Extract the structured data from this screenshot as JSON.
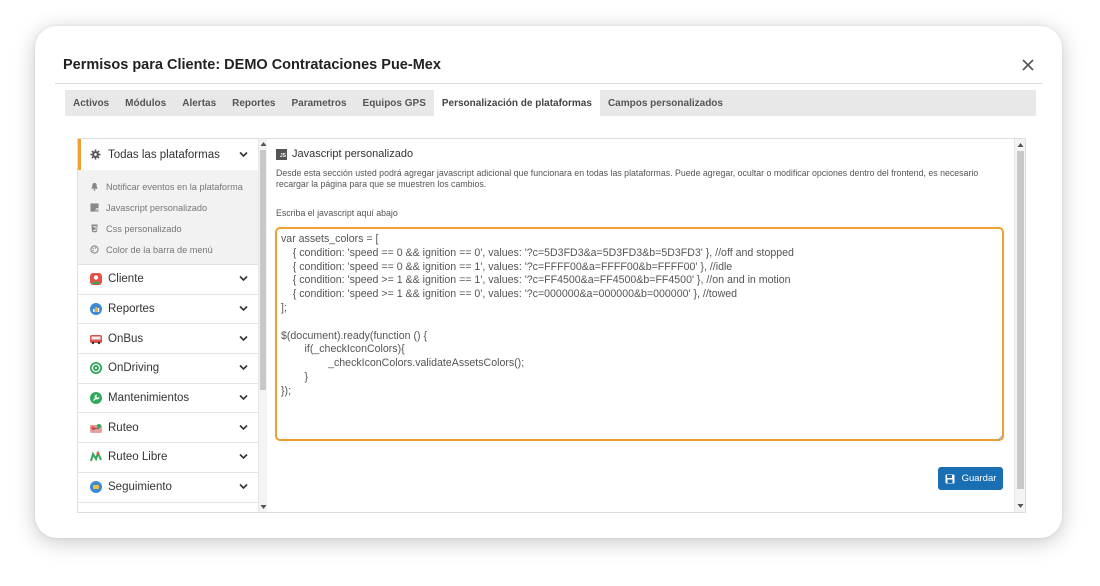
{
  "modal": {
    "title": "Permisos para Cliente: DEMO Contrataciones Pue-Mex"
  },
  "tabs": [
    {
      "label": "Activos"
    },
    {
      "label": "Módulos"
    },
    {
      "label": "Alertas"
    },
    {
      "label": "Reportes"
    },
    {
      "label": "Parametros"
    },
    {
      "label": "Equipos GPS"
    },
    {
      "label": "Personalización de plataformas",
      "active": true
    },
    {
      "label": "Campos personalizados"
    }
  ],
  "sidebar": {
    "header": {
      "label": "Todas las plataformas",
      "icon": "gear-icon"
    },
    "subitems": [
      {
        "label": "Notificar eventos en la plataforma",
        "icon": "bell-icon"
      },
      {
        "label": "Javascript personalizado",
        "icon": "js-file-icon"
      },
      {
        "label": "Css personalizado",
        "icon": "css-file-icon"
      },
      {
        "label": "Color de la barra de menú",
        "icon": "palette-icon"
      }
    ],
    "items": [
      {
        "label": "Cliente",
        "icon": "cliente-icon",
        "color": "#e8504a"
      },
      {
        "label": "Reportes",
        "icon": "reportes-icon",
        "color": "#3b8bd4"
      },
      {
        "label": "OnBus",
        "icon": "onbus-icon",
        "color": "#d9534f"
      },
      {
        "label": "OnDriving",
        "icon": "ondriving-icon",
        "color": "#2eaa5a"
      },
      {
        "label": "Mantenimientos",
        "icon": "mantenimientos-icon",
        "color": "#2eaa5a"
      },
      {
        "label": "Ruteo",
        "icon": "ruteo-icon",
        "color": "#e8504a"
      },
      {
        "label": "Ruteo Libre",
        "icon": "ruteo-libre-icon",
        "color": "#2eaa5a"
      },
      {
        "label": "Seguimiento",
        "icon": "seguimiento-icon",
        "color": "#3b8bd4"
      }
    ]
  },
  "content": {
    "title": "Javascript personalizado",
    "description": "Desde esta sección usted podrá agregar javascript adicional que funcionara en todas las plataformas. Puede agregar, ocultar o modificar opciones dentro del frontend, es necesario recargar la página para que se muestren los cambios.",
    "editor_label": "Escriba el javascript aquí abajo",
    "code": "var assets_colors = [\n    { condition: 'speed == 0 && ignition == 0', values: '?c=5D3FD3&a=5D3FD3&b=5D3FD3' }, //off and stopped\n    { condition: 'speed == 0 && ignition == 1', values: '?c=FFFF00&a=FFFF00&b=FFFF00' }, //idle\n    { condition: 'speed >= 1 && ignition == 1', values: '?c=FF4500&a=FF4500&b=FF4500' }, //on and in motion\n    { condition: 'speed >= 1 && ignition == 0', values: '?c=000000&a=000000&b=000000' }, //towed\n];\n\n$(document).ready(function () {\n        if(_checkIconColors){\n                _checkIconColors.validateAssetsColors();\n        }\n});",
    "save_label": "Guardar"
  },
  "colors": {
    "accent": "#f0a030",
    "primary_button": "#1a6fb3"
  }
}
